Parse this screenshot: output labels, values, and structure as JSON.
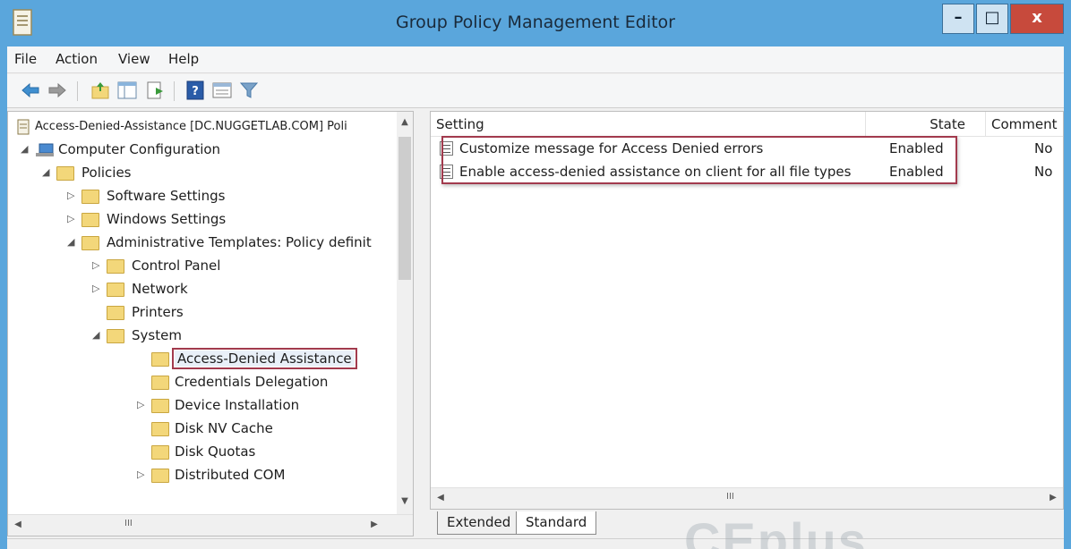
{
  "window": {
    "title": "Group Policy Management Editor",
    "minimize": "–",
    "maximize": "□",
    "close": "x"
  },
  "menu": [
    "File",
    "Action",
    "View",
    "Help"
  ],
  "toolbar_icons": [
    "back-arrow-icon",
    "forward-arrow-icon",
    "up-folder-icon",
    "show-hide-tree-icon",
    "export-list-icon",
    "help-icon",
    "properties-icon",
    "filter-icon"
  ],
  "tree": {
    "root": "Access-Denied-Assistance [DC.NUGGETLAB.COM] Poli",
    "items": [
      {
        "label": "Computer Configuration",
        "expander": "◢"
      },
      {
        "label": "Policies",
        "expander": "◢"
      },
      {
        "label": "Software Settings",
        "expander": "▷"
      },
      {
        "label": "Windows Settings",
        "expander": "▷"
      },
      {
        "label": "Administrative Templates: Policy definit",
        "expander": "◢"
      },
      {
        "label": "Control Panel",
        "expander": "▷"
      },
      {
        "label": "Network",
        "expander": "▷"
      },
      {
        "label": "Printers",
        "expander": ""
      },
      {
        "label": "System",
        "expander": "◢"
      },
      {
        "label": "Access-Denied Assistance",
        "expander": ""
      },
      {
        "label": "Credentials Delegation",
        "expander": ""
      },
      {
        "label": "Device Installation",
        "expander": "▷"
      },
      {
        "label": "Disk NV Cache",
        "expander": ""
      },
      {
        "label": "Disk Quotas",
        "expander": ""
      },
      {
        "label": "Distributed COM",
        "expander": "▷"
      }
    ],
    "hscroll_thumb": "III"
  },
  "list": {
    "columns": [
      "Setting",
      "State",
      "Comment"
    ],
    "rows": [
      {
        "setting": "Customize message for Access Denied errors",
        "state": "Enabled",
        "comment": "No"
      },
      {
        "setting": "Enable access-denied assistance on client for all file types",
        "state": "Enabled",
        "comment": "No"
      }
    ],
    "hscroll_thumb": "III"
  },
  "tabs": [
    "Extended",
    "Standard"
  ],
  "watermark": "CEplus",
  "colors": {
    "titlebar": "#5aa6dc",
    "highlight": "#a23a4d",
    "close": "#c74a3c"
  }
}
